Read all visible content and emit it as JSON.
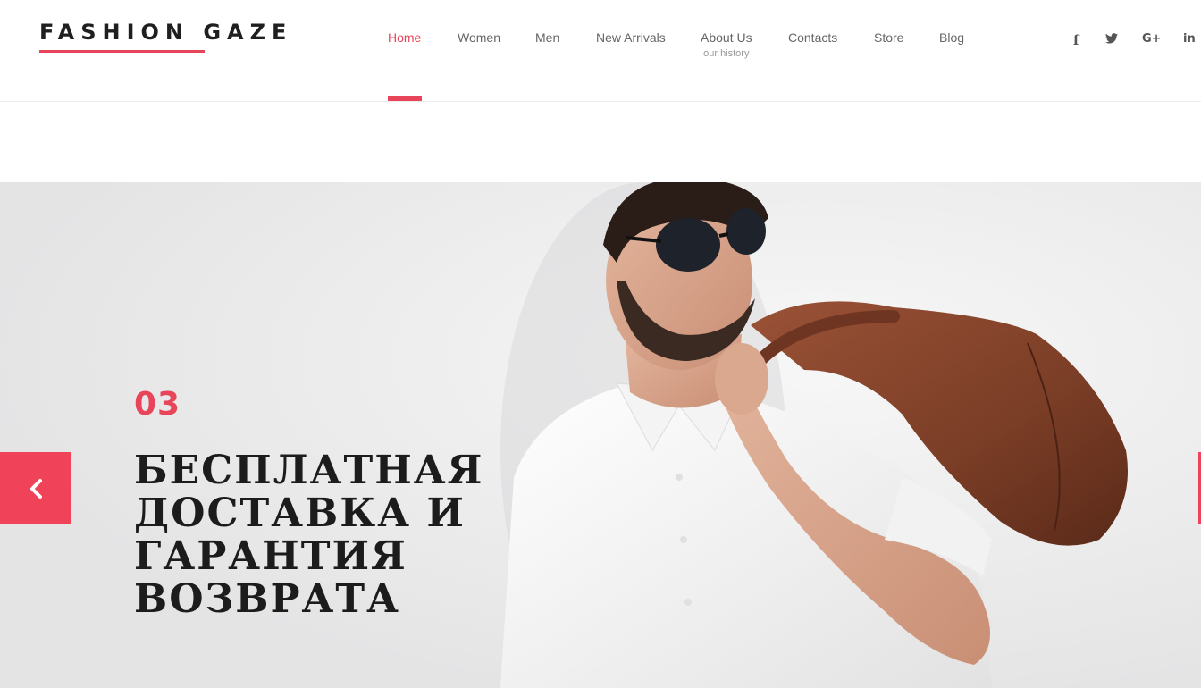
{
  "brand": {
    "name": "FASHION GAZE",
    "accent_color": "#e8455a"
  },
  "nav": {
    "items": [
      {
        "label": "Home",
        "active": true
      },
      {
        "label": "Women"
      },
      {
        "label": "Men"
      },
      {
        "label": "New Arrivals"
      },
      {
        "label": "About Us",
        "sublabel": "our history"
      },
      {
        "label": "Contacts"
      },
      {
        "label": "Store"
      },
      {
        "label": "Blog"
      }
    ]
  },
  "social": {
    "facebook": {
      "icon": "facebook-icon",
      "glyph": "f"
    },
    "twitter": {
      "icon": "twitter-icon",
      "glyph": "🐦"
    },
    "google_plus": {
      "icon": "google-plus-icon",
      "glyph": "G+"
    },
    "linkedin": {
      "icon": "linkedin-icon",
      "glyph": "in"
    }
  },
  "hero": {
    "slide_number": "03",
    "title_lines": [
      "БЕСПЛАТНАЯ",
      "ДОСТАВКА И",
      "ГАРАНТИЯ",
      "ВОЗВРАТА"
    ],
    "prev_icon": "chevron-left-icon",
    "next_icon": "chevron-right-icon",
    "arrow_color": "#f0435a"
  }
}
